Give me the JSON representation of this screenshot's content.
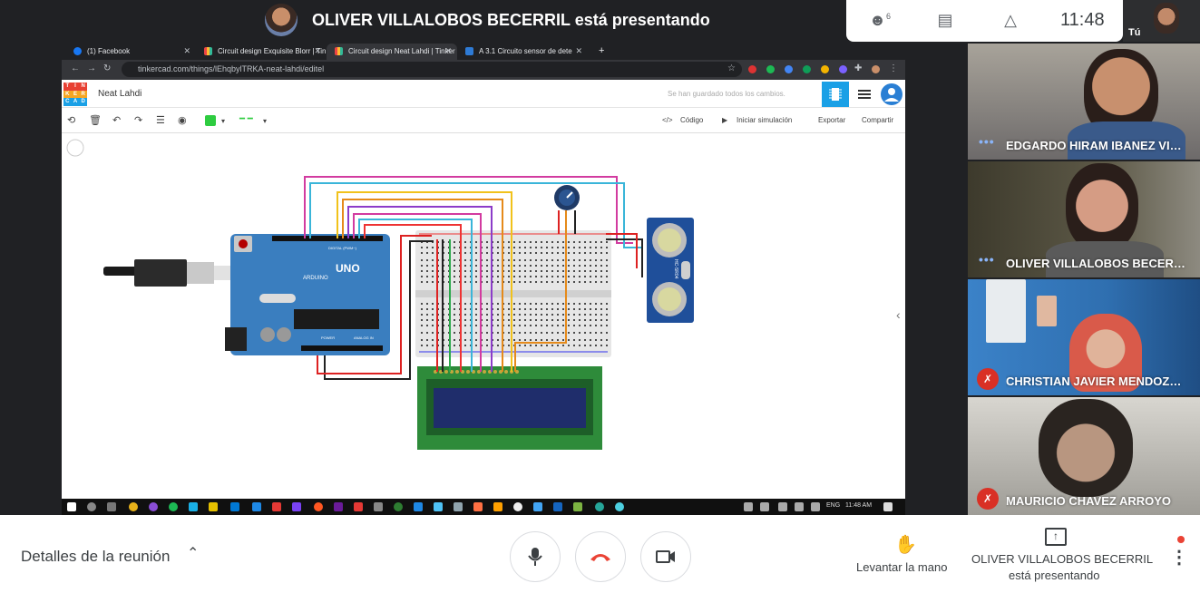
{
  "meet": {
    "presenter_banner": "OLIVER VILLALOBOS BECERRIL está presentando",
    "participant_count": "6",
    "clock": "11:48",
    "self_label": "Tú",
    "meeting_details": "Detalles de la reunión",
    "raise_hand": "Levantar la mano",
    "presenting_line1": "OLIVER VILLALOBOS BECERRIL",
    "presenting_line2": "está presentando",
    "participants": [
      {
        "name": "EDGARDO HIRAM IBANEZ VILL...",
        "muted": false
      },
      {
        "name": "OLIVER VILLALOBOS BECERRIL",
        "muted": false
      },
      {
        "name": "CHRISTIAN JAVIER MENDOZA ...",
        "muted": true
      },
      {
        "name": "MAURICIO CHAVEZ ARROYO",
        "muted": true
      }
    ],
    "icons": {
      "people": "people-icon",
      "chat": "chat-icon",
      "activities": "activities-icon",
      "mic": "mic-icon",
      "hangup": "hangup-icon",
      "camera": "camera-icon",
      "hand": "hand-icon",
      "present": "present-icon",
      "more": "more-vert-icon"
    },
    "colors": {
      "hangup": "#ea4335",
      "mute": "#d93025",
      "accent": "#1a73e8"
    }
  },
  "browser": {
    "tabs": [
      {
        "label": "(1) Facebook",
        "active": false
      },
      {
        "label": "Circuit design Exquisite Blorr | Tin",
        "active": false
      },
      {
        "label": "Circuit design Neat Lahdi | Tinker",
        "active": true
      },
      {
        "label": "A 3.1 Circuito sensor de dete",
        "active": false
      }
    ],
    "url": "tinkercad.com/things/lEhqbylTRKA-neat-lahdi/editel"
  },
  "tinkercad": {
    "logo_letters": [
      "TIN",
      "KER",
      "CAD"
    ],
    "design_name": "Neat Lahdi",
    "saved_status": "Se han guardado todos los cambios.",
    "toolbar": {
      "code": "Código",
      "start_sim": "Iniciar simulación",
      "export": "Exportar",
      "share": "Compartir"
    },
    "board": {
      "brand": "UNO",
      "name": "ARDUINO",
      "digital_label": "DIGITAL (PWM~)",
      "power_label": "POWER",
      "analog_label": "ANALOG IN"
    },
    "sensor_label": "HC-SR04"
  },
  "taskbar": {
    "lang": "ENG",
    "time": "11:48 AM"
  }
}
